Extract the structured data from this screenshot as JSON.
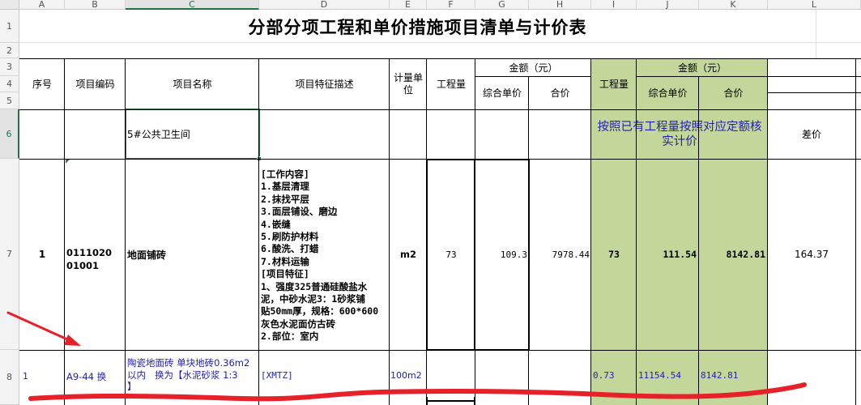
{
  "column_headers": [
    "A",
    "B",
    "C",
    "D",
    "E",
    "F",
    "G",
    "H",
    "I",
    "J",
    "K",
    "L"
  ],
  "row_headers": [
    "1",
    "2",
    "3",
    "4",
    "5",
    "6",
    "7",
    "8"
  ],
  "sheet": {
    "title": "分部分项工程和单价措施项目清单与计价表",
    "headers": {
      "seq": "序号",
      "code": "项目编码",
      "name": "项目名称",
      "desc": "项目特征描述",
      "unit": "计量单位",
      "qty": "工程量",
      "amount": "金额（元）",
      "unit_price": "综合单价",
      "total": "合价",
      "qty2": "工程量",
      "amount2": "金额（元）",
      "unit_price2": "综合单价",
      "total2": "合价"
    },
    "row6": {
      "name": "5#公共卫生间",
      "note": "按照已有工程量按照对应定额核实计价",
      "diff": "差价"
    },
    "row7": {
      "seq": "1",
      "code": "011102001001",
      "name": "地面铺砖",
      "desc": "[工作内容]\n1.基层清理\n2.抹找平层\n3.面层铺设、磨边\n4.嵌缝\n5.刷防护材料\n6.酸洗、打蜡\n7.材料运输\n[项目特征]\n1、强度325普通硅酸盐水\n泥，中砂水泥3：1砂浆铺\n贴50mm厚，规格：600*600\n灰色水泥面仿古砖\n2.部位：室内",
      "unit": "m2",
      "qty": "73",
      "unit_price": "109.3",
      "total": "7978.44",
      "qty2": "73",
      "unit_price2": "111.54",
      "total2": "8142.81",
      "diff": "164.37"
    },
    "row8": {
      "seq": "1",
      "code": "A9-44 换",
      "name": "陶瓷地面砖 单块地砖0.36m2\n以内   换为【水泥砂浆 1:3\n】",
      "desc": "[XMTZ]",
      "unit": "100m2",
      "qty2": "0.73",
      "unit_price2": "11154.54",
      "total2": "8142.81"
    }
  },
  "colors": {
    "green_fill": "#c4d79b",
    "annotation_red": "#e8202a",
    "selection_green": "#217346",
    "blue_text": "#1f1fb5"
  }
}
